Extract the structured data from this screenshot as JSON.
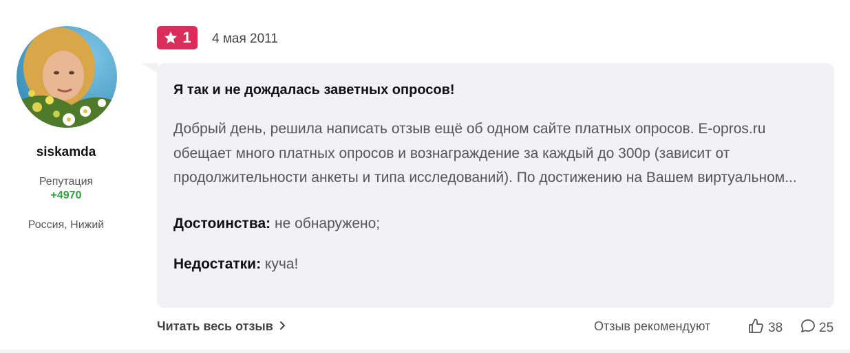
{
  "author": {
    "username": "siskamda",
    "reputation_label": "Репутация",
    "reputation_value": "+4970",
    "location": "Россия, Нижий"
  },
  "review": {
    "rating": "1",
    "date": "4 мая 2011",
    "title": "Я так и не дождалась заветных опросов!",
    "text": "Добрый день, решила написать отзыв ещё об одном сайте платных опросов. E-opros.ru обещает много платных опросов и вознаграждение за каждый до 300р (зависит от продолжительности анкеты и типа исследований). По достижению на Вашем виртуальном...",
    "pros_label": "Достоинства:",
    "pros_value": "не обнаружено;",
    "cons_label": "Недостатки:",
    "cons_value": "куча!"
  },
  "footer": {
    "read_more": "Читать весь отзыв",
    "recommend_label": "Отзыв рекомендуют",
    "likes": "38",
    "comments": "25"
  },
  "colors": {
    "badge": "#d92e5b",
    "reputation": "#2ea33a",
    "bubble": "#f2f2f4"
  },
  "icons": [
    "star-icon",
    "chevron-right-icon",
    "thumbs-up-icon",
    "comment-icon"
  ]
}
